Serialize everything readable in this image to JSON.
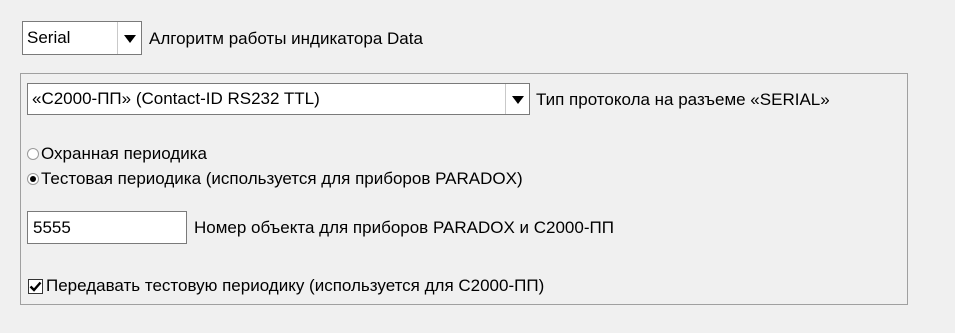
{
  "indicator": {
    "mode_value": "Serial",
    "label": "Алгоритм работы индикатора Data"
  },
  "protocol": {
    "value": "«С2000-ПП» (Contact-ID RS232 TTL)",
    "label": "Тип протокола на разъеме «SERIAL»"
  },
  "periodic": {
    "option_guard": "Охранная периодика",
    "option_test": "Тестовая периодика (используется для приборов PARADOX)",
    "selected": "test"
  },
  "object_number": {
    "value": "5555",
    "label": "Номер объекта для приборов PARADOX и С2000-ПП"
  },
  "send_test": {
    "label": "Передавать тестовую периодику (используется для С2000-ПП)",
    "checked": true
  }
}
